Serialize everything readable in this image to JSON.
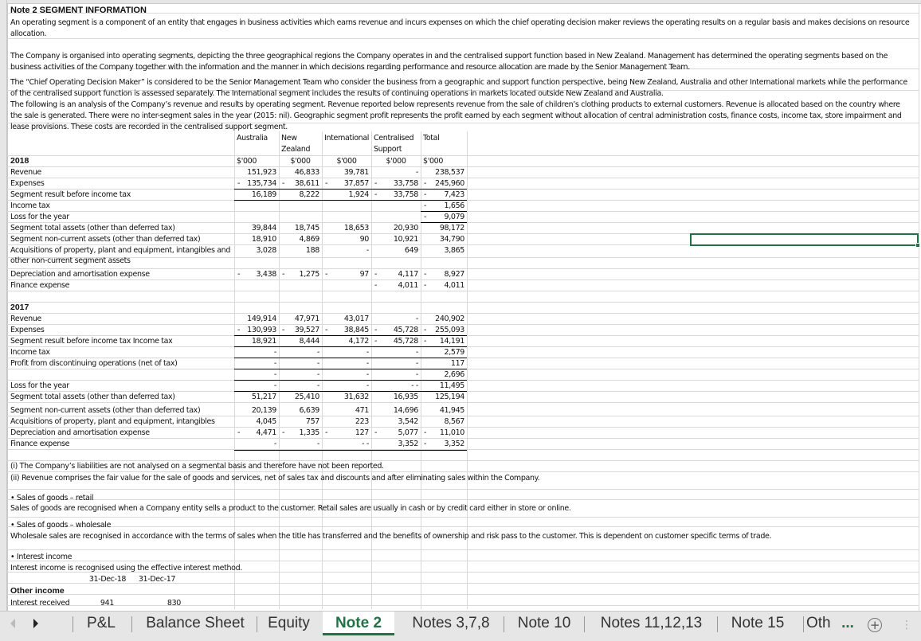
{
  "title": "Note 2 SEGMENT INFORMATION",
  "paragraphs": {
    "p1": "An operating segment is a component of an entity that engages in business activities which earns revenue and incurs expenses on which the chief operating decision maker reviews the operating results on a regular basis and makes decisions on resource allocation.",
    "p2": "The Company is organised into operating segments, depicting the three geographical regions the Company operates in and the centralised support function based in New Zealand. Management has determined the operating segments based on the business activities of the Company together with the information and the manner in which decisions regarding performance and resource allocation are made by the Senior Management Team.",
    "p3": "The “Chief Operating Decision Maker” is considered to be the Senior Management Team who consider the business from a geographic and support function perspective, being New Zealand, Australia and other International markets while the performance of the centralised support function is assessed separately. The International segment includes the results of continuing operations in markets located outside New Zealand and Australia.",
    "p4": "The following is an analysis of the Company’s revenue and results by operating segment. Revenue reported below represents revenue from the sale of children’s clothing products to external customers. Revenue is allocated based on the country where the sale is generated. There were no inter-segment sales in the year (2015: nil). Geographic segment profit represents the profit earned by each segment without allocation of central administration costs, finance costs, income tax, store impairment and lease provisions. These costs are recorded in the centralised support segment."
  },
  "table": {
    "headers": [
      "Australia",
      "New Zealand",
      "International",
      "Centralised Support",
      "Total"
    ],
    "header_lines": [
      [
        "Australia",
        ""
      ],
      [
        "New",
        "Zealand"
      ],
      [
        "International",
        ""
      ],
      [
        "Centralised",
        "Support"
      ],
      [
        "Total",
        ""
      ]
    ],
    "unit": "$'000",
    "y2018": {
      "label": "2018",
      "rows": [
        {
          "label": "Revenue",
          "values": [
            "151,923",
            "46,833",
            "39,781",
            "-",
            "238,537"
          ]
        },
        {
          "label": "Expenses",
          "values": [
            "- 135,734",
            "- 38,611",
            "- 37,857",
            "- 33,758",
            "- 245,960"
          ]
        },
        {
          "label": "Segment result before income tax",
          "values": [
            "16,189",
            "8,222",
            "1,924",
            "- 33,758",
            "- 7,423"
          ]
        },
        {
          "label": "Income tax",
          "values": [
            "",
            "",
            "",
            "",
            "- 1,656"
          ]
        },
        {
          "label": "Loss for the year",
          "values": [
            "",
            "",
            "",
            "",
            "- 9,079"
          ]
        },
        {
          "label": "Segment total assets (other than deferred tax)",
          "values": [
            "39,844",
            "18,745",
            "18,653",
            "20,930",
            "98,172"
          ]
        },
        {
          "label": "Segment non-current assets (other than deferred tax)",
          "values": [
            "18,910",
            "4,869",
            "90",
            "10,921",
            "34,790"
          ]
        },
        {
          "label": "Acquisitions of property, plant and equipment, intangibles and other non-current segment assets",
          "values": [
            "3,028",
            "188",
            "-",
            "649",
            "3,865"
          ]
        },
        {
          "label": "Depreciation and amortisation expense",
          "values": [
            "- 3,438",
            "- 1,275",
            "- 97",
            "- 4,117",
            "- 8,927"
          ]
        },
        {
          "label": "Finance expense",
          "values": [
            "",
            "",
            "",
            "- 4,011",
            "- 4,011"
          ]
        }
      ]
    },
    "y2017": {
      "label": "2017",
      "rows": [
        {
          "label": "Revenue",
          "values": [
            "149,914",
            "47,971",
            "43,017",
            "-",
            "240,902"
          ]
        },
        {
          "label": "Expenses",
          "values": [
            "- 130,993",
            "- 39,527",
            "- 38,845",
            "- 45,728",
            "- 255,093"
          ]
        },
        {
          "label": "Segment result before income tax Income tax",
          "values": [
            "18,921",
            "8,444",
            "4,172",
            "- 45,728",
            "- 14,191"
          ]
        },
        {
          "label": "Income tax",
          "values": [
            "-",
            "-",
            "-",
            "-",
            "2,579"
          ]
        },
        {
          "label": "Profit from discontinuing operations (net of tax)",
          "values": [
            "-",
            "-",
            "-",
            "-",
            "117"
          ]
        },
        {
          "label": "",
          "values": [
            "-",
            "-",
            "-",
            "-",
            "2,696"
          ]
        },
        {
          "label": "Loss for the year",
          "values": [
            "-",
            "-",
            "-",
            "- -",
            "11,495"
          ]
        },
        {
          "label": "Segment total assets (other than deferred tax)",
          "values": [
            "51,217",
            "25,410",
            "31,632",
            "16,935",
            "125,194"
          ]
        },
        {
          "label": "Segment non-current assets (other than deferred tax)",
          "values": [
            "20,139",
            "6,639",
            "471",
            "14,696",
            "41,945"
          ]
        },
        {
          "label": "Acquisitions of property, plant and equipment, intangibles",
          "values": [
            "4,045",
            "757",
            "223",
            "3,542",
            "8,567"
          ]
        },
        {
          "label": "Depreciation and amortisation expense",
          "values": [
            "- 4,471",
            "- 1,335",
            "- 127",
            "- 5,077",
            "- 11,010"
          ]
        },
        {
          "label": "Finance expense",
          "values": [
            "-",
            "-",
            "- -",
            "3,352",
            "- 3,352"
          ]
        }
      ]
    }
  },
  "notes": {
    "n1": "(i) The Company’s liabilities are not analysed on a segmental basis and therefore have not been reported.",
    "n2": "(ii) Revenue comprises the fair value for the sale of goods and services, net of sales tax and discounts and after eliminating sales within the Company.",
    "retail_head": "• Sales of goods – retail",
    "retail_text": "Sales of goods are recognised when a Company entity sells a product to the customer. Retail sales are usually in cash or by credit card either in store or online.",
    "wholesale_head": "• Sales of goods – wholesale",
    "wholesale_text": "Wholesale sales are recognised in accordance with the terms of sales when the title has transferred and the benefits of ownership and risk pass to the customer. This is dependent on customer  specific terms of trade.",
    "interest_head": "• Interest income",
    "interest_text": "Interest income is recognised using the effective interest method."
  },
  "other_income": {
    "dates": [
      "31-Dec-18",
      "31-Dec-17"
    ],
    "heading": "Other income",
    "row_label": "Interest received",
    "values": [
      "941",
      "830"
    ]
  },
  "sheet_tabs": {
    "tabs": [
      "P&L",
      "Balance Sheet",
      "Equity",
      "Note 2",
      "Notes 3,7,8",
      "Note 10",
      "Notes 11,12,13",
      "Note 15",
      "Oth"
    ],
    "active": "Note 2",
    "more": "...",
    "add": "+"
  }
}
